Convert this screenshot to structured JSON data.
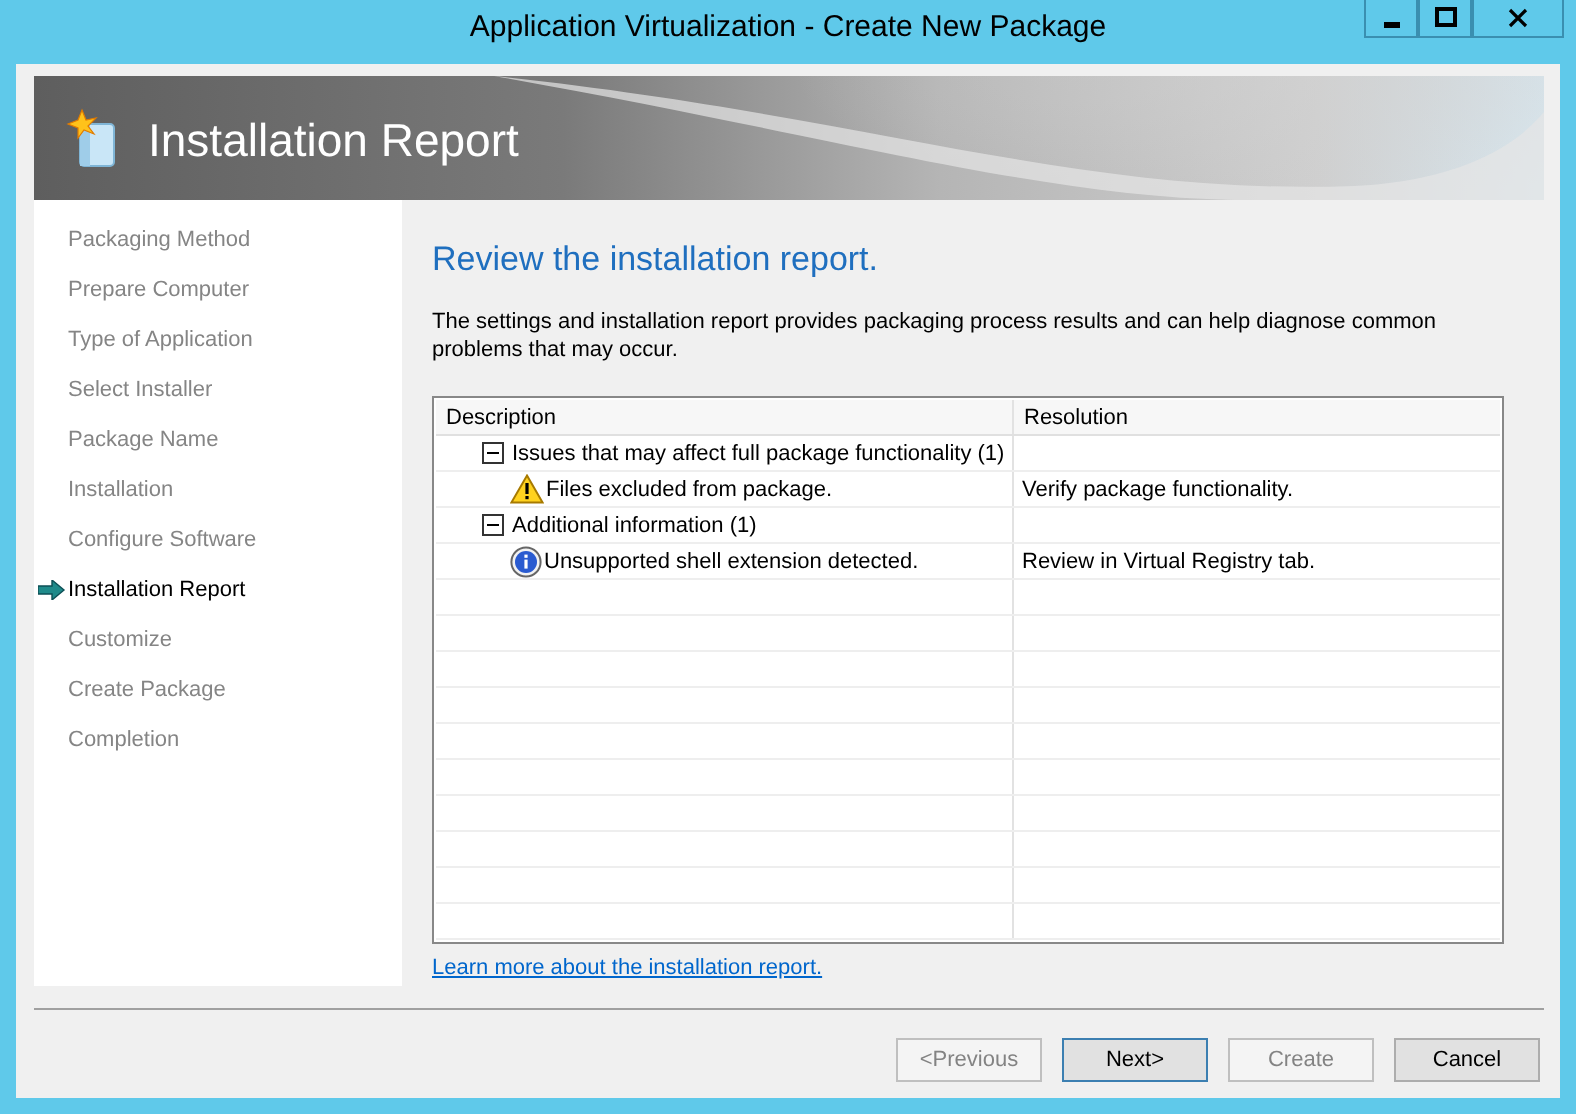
{
  "window": {
    "title": "Application Virtualization - Create New Package"
  },
  "banner": {
    "title": "Installation Report"
  },
  "steps": [
    {
      "label": "Packaging Method",
      "selected": false
    },
    {
      "label": "Prepare Computer",
      "selected": false
    },
    {
      "label": "Type of Application",
      "selected": false
    },
    {
      "label": "Select Installer",
      "selected": false
    },
    {
      "label": "Package Name",
      "selected": false
    },
    {
      "label": "Installation",
      "selected": false
    },
    {
      "label": "Configure Software",
      "selected": false
    },
    {
      "label": "Installation Report",
      "selected": true
    },
    {
      "label": "Customize",
      "selected": false
    },
    {
      "label": "Create Package",
      "selected": false
    },
    {
      "label": "Completion",
      "selected": false
    }
  ],
  "heading": "Review the installation report.",
  "intro": "The settings and installation report provides packaging process results and can help diagnose common problems that may occur.",
  "table": {
    "columns": [
      "Description",
      "Resolution"
    ],
    "groups": [
      {
        "label": "Issues that may affect full package functionality (1)",
        "expanded": true,
        "items": [
          {
            "kind": "warning",
            "description": "Files excluded from package.",
            "resolution": "Verify package functionality."
          }
        ]
      },
      {
        "label": "Additional information (1)",
        "expanded": true,
        "items": [
          {
            "kind": "info",
            "description": "Unsupported shell extension detected.",
            "resolution": "Review in Virtual Registry tab."
          }
        ]
      }
    ]
  },
  "link": "Learn more about the installation report.",
  "buttons": [
    {
      "label": "<Previous",
      "disabled": true,
      "default": false
    },
    {
      "label": "Next>",
      "disabled": false,
      "default": true
    },
    {
      "label": "Create",
      "disabled": true,
      "default": false
    },
    {
      "label": "Cancel",
      "disabled": false,
      "default": false
    }
  ]
}
